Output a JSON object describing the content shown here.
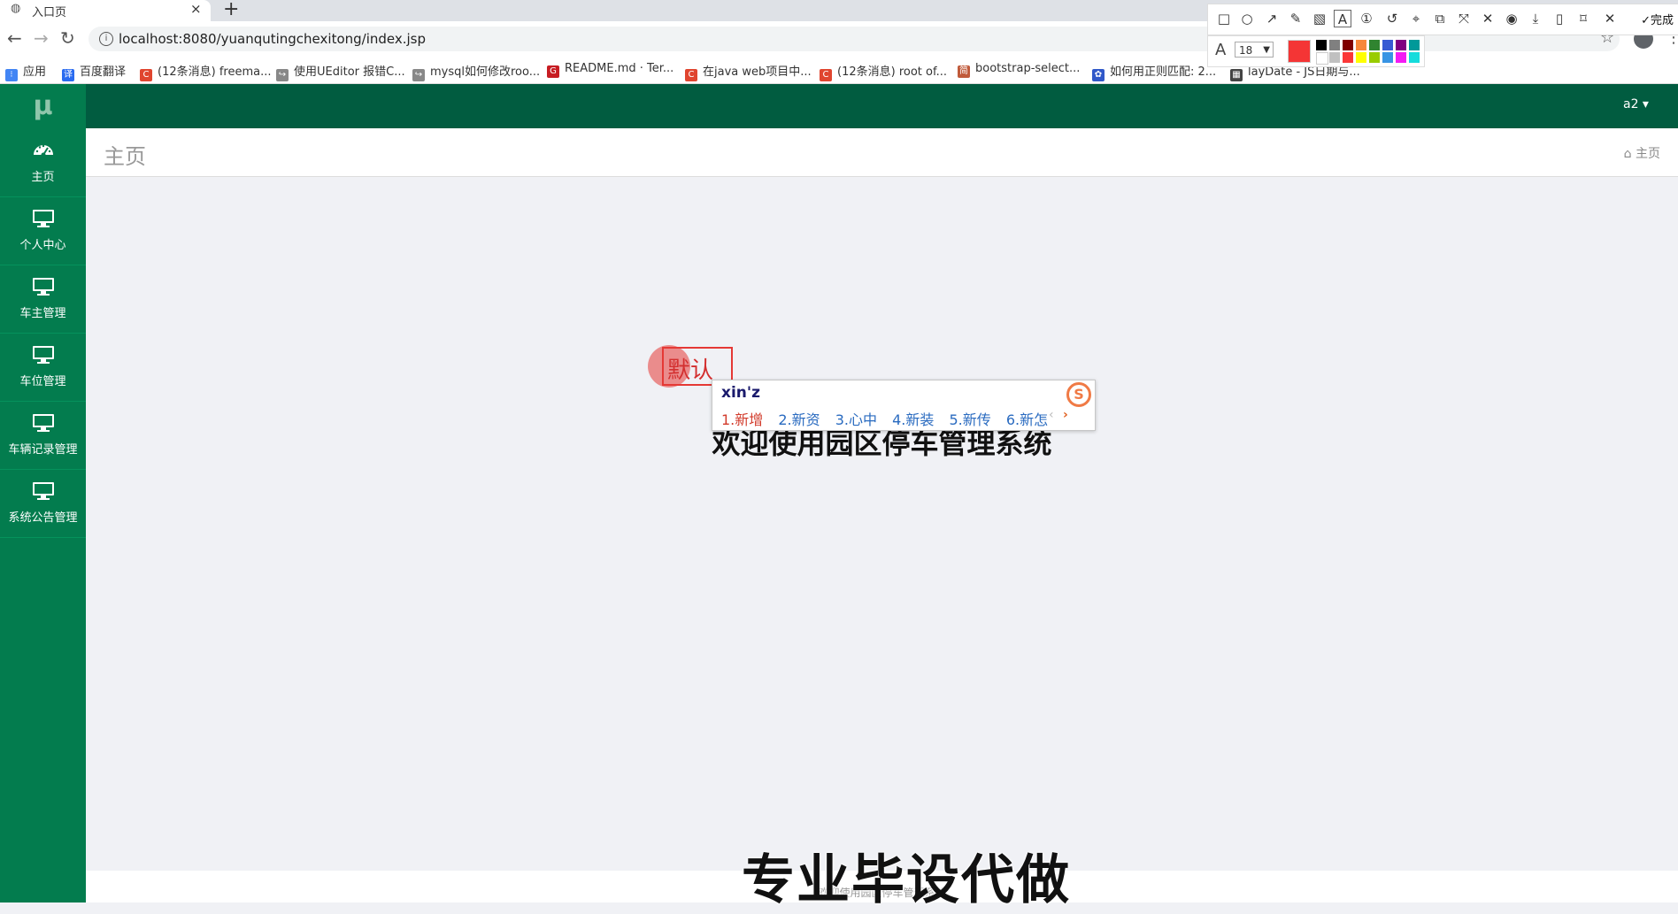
{
  "browser": {
    "tab_title": "入口页",
    "tab_close": "×",
    "new_tab": "+",
    "url": "localhost:8080/yuanqutingchexitong/index.jsp",
    "bookmarks": [
      {
        "label": "应用",
        "color": "#4285f4"
      },
      {
        "label": "百度翻译",
        "color": "#2a6bf0"
      },
      {
        "label": "(12条消息) freema...",
        "color": "#e0452f"
      },
      {
        "label": "使用UEditor 报错C...",
        "color": "#888888"
      },
      {
        "label": "mysql如何修改roo...",
        "color": "#888888"
      },
      {
        "label": "README.md · Ter...",
        "color": "#c71d23"
      },
      {
        "label": "在java web项目中...",
        "color": "#e0452f"
      },
      {
        "label": "(12条消息) root of...",
        "color": "#e0452f"
      },
      {
        "label": "bootstrap-select...",
        "color": "#c05a3a"
      },
      {
        "label": "如何用正则匹配: 2...",
        "color": "#3058c9"
      },
      {
        "label": "layDate - JS日期与...",
        "color": "#444444"
      }
    ]
  },
  "app": {
    "brand": "μ",
    "user_menu": "a2 ▾",
    "sidebar": [
      {
        "label": "主页",
        "icon": "dashboard-icon"
      },
      {
        "label": "个人中心",
        "icon": "monitor-icon"
      },
      {
        "label": "车主管理",
        "icon": "monitor-icon"
      },
      {
        "label": "车位管理",
        "icon": "monitor-icon"
      },
      {
        "label": "车辆记录管理",
        "icon": "monitor-icon"
      },
      {
        "label": "系统公告管理",
        "icon": "monitor-icon"
      }
    ],
    "page_title": "主页",
    "breadcrumb": "主页",
    "welcome": "欢迎使用园区停车管理系统",
    "footer": "欢迎使用园区停车管理系统"
  },
  "overlay": {
    "annotation_text": "默认",
    "watermark": "专业毕设代做",
    "ime": {
      "input": "xin'z",
      "logo": "S",
      "candidates": [
        "1.新增",
        "2.新资",
        "3.心中",
        "4.新装",
        "5.新传",
        "6.新怎"
      ]
    },
    "toolbar": {
      "done_label": "完成",
      "font_size": "18",
      "current_color": "#f43535",
      "swatches": [
        "#000000",
        "#808080",
        "#800000",
        "#f7883a",
        "#308430",
        "#385ad3",
        "#800080",
        "#009999",
        "#ffffff",
        "#c0c0c0",
        "#fb3838",
        "#ffff00",
        "#99cc00",
        "#3894e4",
        "#f31bf3",
        "#16dcdc"
      ]
    }
  }
}
